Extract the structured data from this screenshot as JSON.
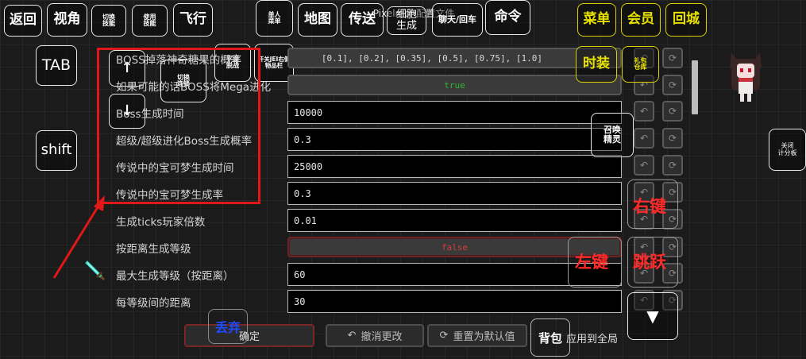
{
  "top_toolbar": {
    "back": "返回",
    "view": "视角",
    "switch_skill": "切换\n技能",
    "use_skill": "使用\n技能",
    "fly": "飞行",
    "single_menu": "单人\n菜单",
    "map": "地图",
    "teleport": "传送",
    "cell_generate": "细胞\n生成",
    "chat_enter": "聊天/回车",
    "command": "命令",
    "menu": "菜单",
    "vip": "会员",
    "return_city": "回城"
  },
  "screen_title": "Pixelmon配置文件",
  "left_controls": {
    "tab": "TAB",
    "shift": "shift",
    "up_arrow": "↑",
    "down_arrow": "↓",
    "switch_link": "切换\n连锁",
    "quick_escape": "平面\n脱战",
    "jei_toggle": "开关JEI右侧\n物品栏"
  },
  "right_controls": {
    "fashion": "时装",
    "gift_warehouse": "礼包\n仓库",
    "summon_spirit": "召唤\n精灵",
    "close_scoreboard": "关闭\n计分板",
    "right_click": "右键",
    "left_click": "左键",
    "jump": "跳跃",
    "triangle": "▼",
    "discard": "丢弃",
    "backpack": "背包"
  },
  "config": {
    "rows": [
      {
        "label": "BOSS掉落神奇糖果的概率",
        "value": "[0.1], [0.2], [0.35], [0.5], [0.75], [1.0]",
        "kind": "list"
      },
      {
        "label": "如果可能的话BOSS将Mega进化",
        "value": "true",
        "kind": "bool"
      },
      {
        "label": "Boss生成时间",
        "value": "10000",
        "kind": "text"
      },
      {
        "label": "超级/超级进化Boss生成概率",
        "value": "0.3",
        "kind": "text"
      },
      {
        "label": "传说中的宝可梦生成时间",
        "value": "25000",
        "kind": "text"
      },
      {
        "label": "传说中的宝可梦生成率",
        "value": "0.3",
        "kind": "text"
      },
      {
        "label": "生成ticks玩家倍数",
        "value": "0.01",
        "kind": "text"
      },
      {
        "label": "按距离生成等级",
        "value": "false",
        "kind": "bool"
      },
      {
        "label": "最大生成等级（按距离）",
        "value": "60",
        "kind": "text"
      },
      {
        "label": "每等级间的距离",
        "value": "30",
        "kind": "text"
      }
    ],
    "undo_icon": "↶",
    "reset_icon": "⟳"
  },
  "bottom_bar": {
    "confirm": "确定",
    "undo_changes": "撤消更改",
    "reset_default": "重置为默认值",
    "apply_global": "应用到全局"
  },
  "colors": {
    "highlight_red": "#e01818",
    "button_yellow": "#d9d200",
    "true_green": "#2fb82f",
    "false_red": "#d23c3c"
  }
}
